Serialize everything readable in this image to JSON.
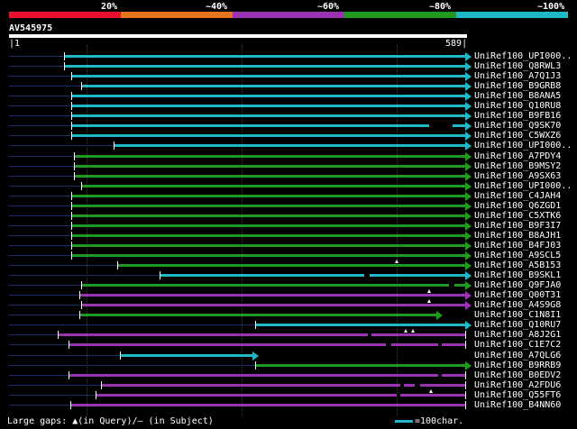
{
  "scale": {
    "labels": [
      "20%",
      "~40%",
      "~60%",
      "~80%",
      "~100%"
    ],
    "colors": [
      "#e8112d",
      "#e8741c",
      "#9b32b4",
      "#1f9a1f",
      "#1fb8c4"
    ]
  },
  "query": {
    "name": "AV545975",
    "start": "1",
    "end": "589"
  },
  "hits": [
    {
      "name": "UniRef100_UPI000..",
      "color": "cyan"
    },
    {
      "name": "UniRef100_Q8RWL3",
      "color": "cyan"
    },
    {
      "name": "UniRef100_A7Q1J3",
      "color": "cyan"
    },
    {
      "name": "UniRef100_B9GRB8",
      "color": "cyan"
    },
    {
      "name": "UniRef100_B8ANA5",
      "color": "cyan"
    },
    {
      "name": "UniRef100_Q10RU8",
      "color": "cyan"
    },
    {
      "name": "UniRef100_B9FB16",
      "color": "cyan"
    },
    {
      "name": "UniRef100_Q9SK70",
      "color": "cyan"
    },
    {
      "name": "UniRef100_C5WXZ6",
      "color": "cyan"
    },
    {
      "name": "UniRef100_UPI000..",
      "color": "cyan"
    },
    {
      "name": "UniRef100_A7PDY4",
      "color": "green"
    },
    {
      "name": "UniRef100_B9MSY2",
      "color": "green"
    },
    {
      "name": "UniRef100_A9SX63",
      "color": "green"
    },
    {
      "name": "UniRef100_UPI000..",
      "color": "green"
    },
    {
      "name": "UniRef100_C4JAH4",
      "color": "green"
    },
    {
      "name": "UniRef100_Q6ZGD1",
      "color": "green"
    },
    {
      "name": "UniRef100_C5XTK6",
      "color": "green"
    },
    {
      "name": "UniRef100_B9F3I7",
      "color": "green"
    },
    {
      "name": "UniRef100_B8AJH1",
      "color": "green"
    },
    {
      "name": "UniRef100_B4FJ03",
      "color": "green"
    },
    {
      "name": "UniRef100_A9SCL5",
      "color": "green"
    },
    {
      "name": "UniRef100_A5B153",
      "color": "green"
    },
    {
      "name": "UniRef100_B9SKL1",
      "color": "cyan"
    },
    {
      "name": "UniRef100_Q9FJA0",
      "color": "green"
    },
    {
      "name": "UniRef100_Q00T31",
      "color": "purple"
    },
    {
      "name": "UniRef100_A4S9G8",
      "color": "purple"
    },
    {
      "name": "UniRef100_C1N8I1",
      "color": "green"
    },
    {
      "name": "UniRef100_Q10RU7",
      "color": "cyan"
    },
    {
      "name": "UniRef100_A8J2G1",
      "color": "purple"
    },
    {
      "name": "UniRef100_C1E7C2",
      "color": "purple"
    },
    {
      "name": "UniRef100_A7QLG6",
      "color": "cyan"
    },
    {
      "name": "UniRef100_B9RRB9",
      "color": "green"
    },
    {
      "name": "UniRef100_B0EDV2",
      "color": "purple"
    },
    {
      "name": "UniRef100_A2FDU6",
      "color": "purple"
    },
    {
      "name": "UniRef100_Q55FT6",
      "color": "purple"
    },
    {
      "name": "UniRef100_B4NN60",
      "color": "purple"
    }
  ],
  "legend": {
    "gaps_text": "Large gaps: ▲(in Query)/– (in Subject)",
    "scale_text": "=100char."
  },
  "palette": {
    "cyan": "#1fb8c4",
    "green": "#1f9a1f",
    "purple": "#9b32b4",
    "navy": "#1c2a6a"
  }
}
